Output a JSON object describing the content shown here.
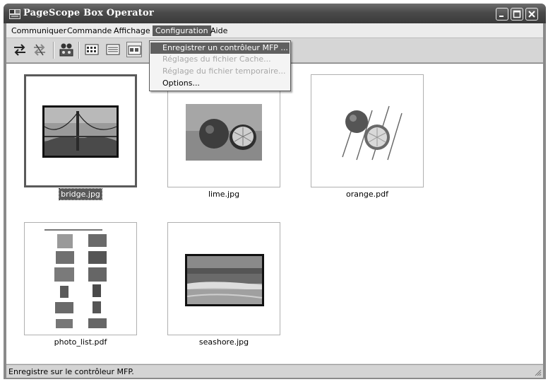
{
  "window": {
    "title": "PageScope Box Operator"
  },
  "menubar": {
    "items": [
      {
        "label": "Communiquer"
      },
      {
        "label": "Commande"
      },
      {
        "label": "Affichage"
      },
      {
        "label": "Configuration"
      },
      {
        "label": "Aide"
      }
    ]
  },
  "dropdown": {
    "items": [
      {
        "label": "Enregistrer un contrôleur MFP ...",
        "state": "highlighted"
      },
      {
        "label": "Réglages du fichier Cache...",
        "state": "disabled"
      },
      {
        "label": "Réglage du fichier temporaire...",
        "state": "disabled"
      },
      {
        "label": "Options...",
        "state": "normal"
      }
    ]
  },
  "files": [
    {
      "name": "bridge.jpg",
      "selected": true
    },
    {
      "name": "lime.jpg",
      "selected": false
    },
    {
      "name": "orange.pdf",
      "selected": false
    },
    {
      "name": "photo_list.pdf",
      "selected": false
    },
    {
      "name": "seashore.jpg",
      "selected": false
    }
  ],
  "statusbar": {
    "text": "Enregistre sur le contrôleur MFP."
  },
  "colors": {
    "titlebar": "#3a3a3a",
    "highlight": "#5b5b5b",
    "background": "#ffffff"
  }
}
